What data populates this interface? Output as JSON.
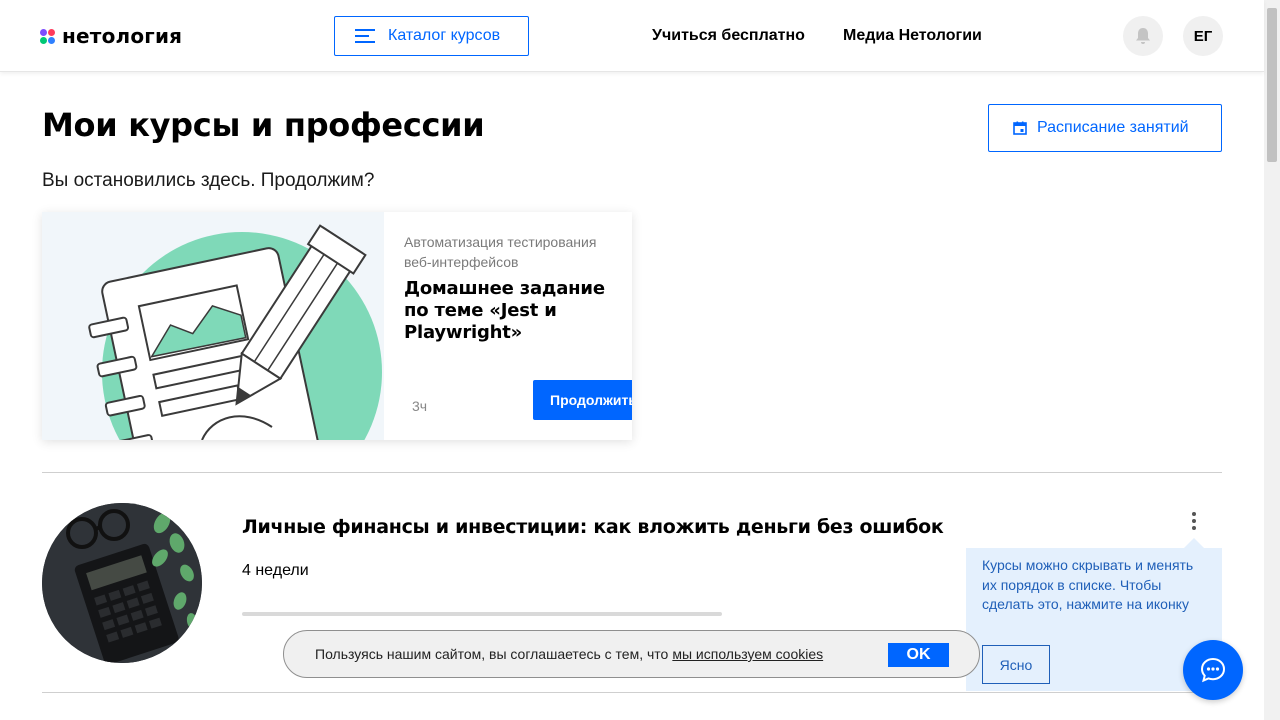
{
  "header": {
    "logo_text": "нетология",
    "catalog_label": "Каталог курсов",
    "nav": [
      {
        "label": "Учиться бесплатно"
      },
      {
        "label": "Медиа Нетологии"
      }
    ],
    "avatar_initials": "ЕГ",
    "bell_icon": "bell-icon"
  },
  "main": {
    "title": "Мои курсы и профессии",
    "schedule_label": "Расписание занятий",
    "subtitle": "Вы остановились здесь. Продолжим?"
  },
  "continue_card": {
    "course": "Автоматизация тестирования веб-интерфейсов",
    "lesson": "Домашнее задание по теме «Jest и Playwright»",
    "time": "3ч",
    "button_label": "Продолжить"
  },
  "course": {
    "title": "Личные финансы и инвестиции: как вложить деньги без ошибок",
    "duration": "4 недели",
    "progress": 0
  },
  "tooltip": {
    "text": "Курсы можно скрывать и менять их порядок в списке. Чтобы сделать это, нажмите на иконку",
    "button_label": "Ясно"
  },
  "cookie": {
    "text": "Пользуясь нашим сайтом, вы соглашаетесь с тем, что",
    "link": "мы используем cookies",
    "ok_label": "OK"
  },
  "colors": {
    "accent": "#0066ff",
    "tooltip_bg": "#e4f0fd",
    "illustration_green": "#7fd9b8"
  }
}
